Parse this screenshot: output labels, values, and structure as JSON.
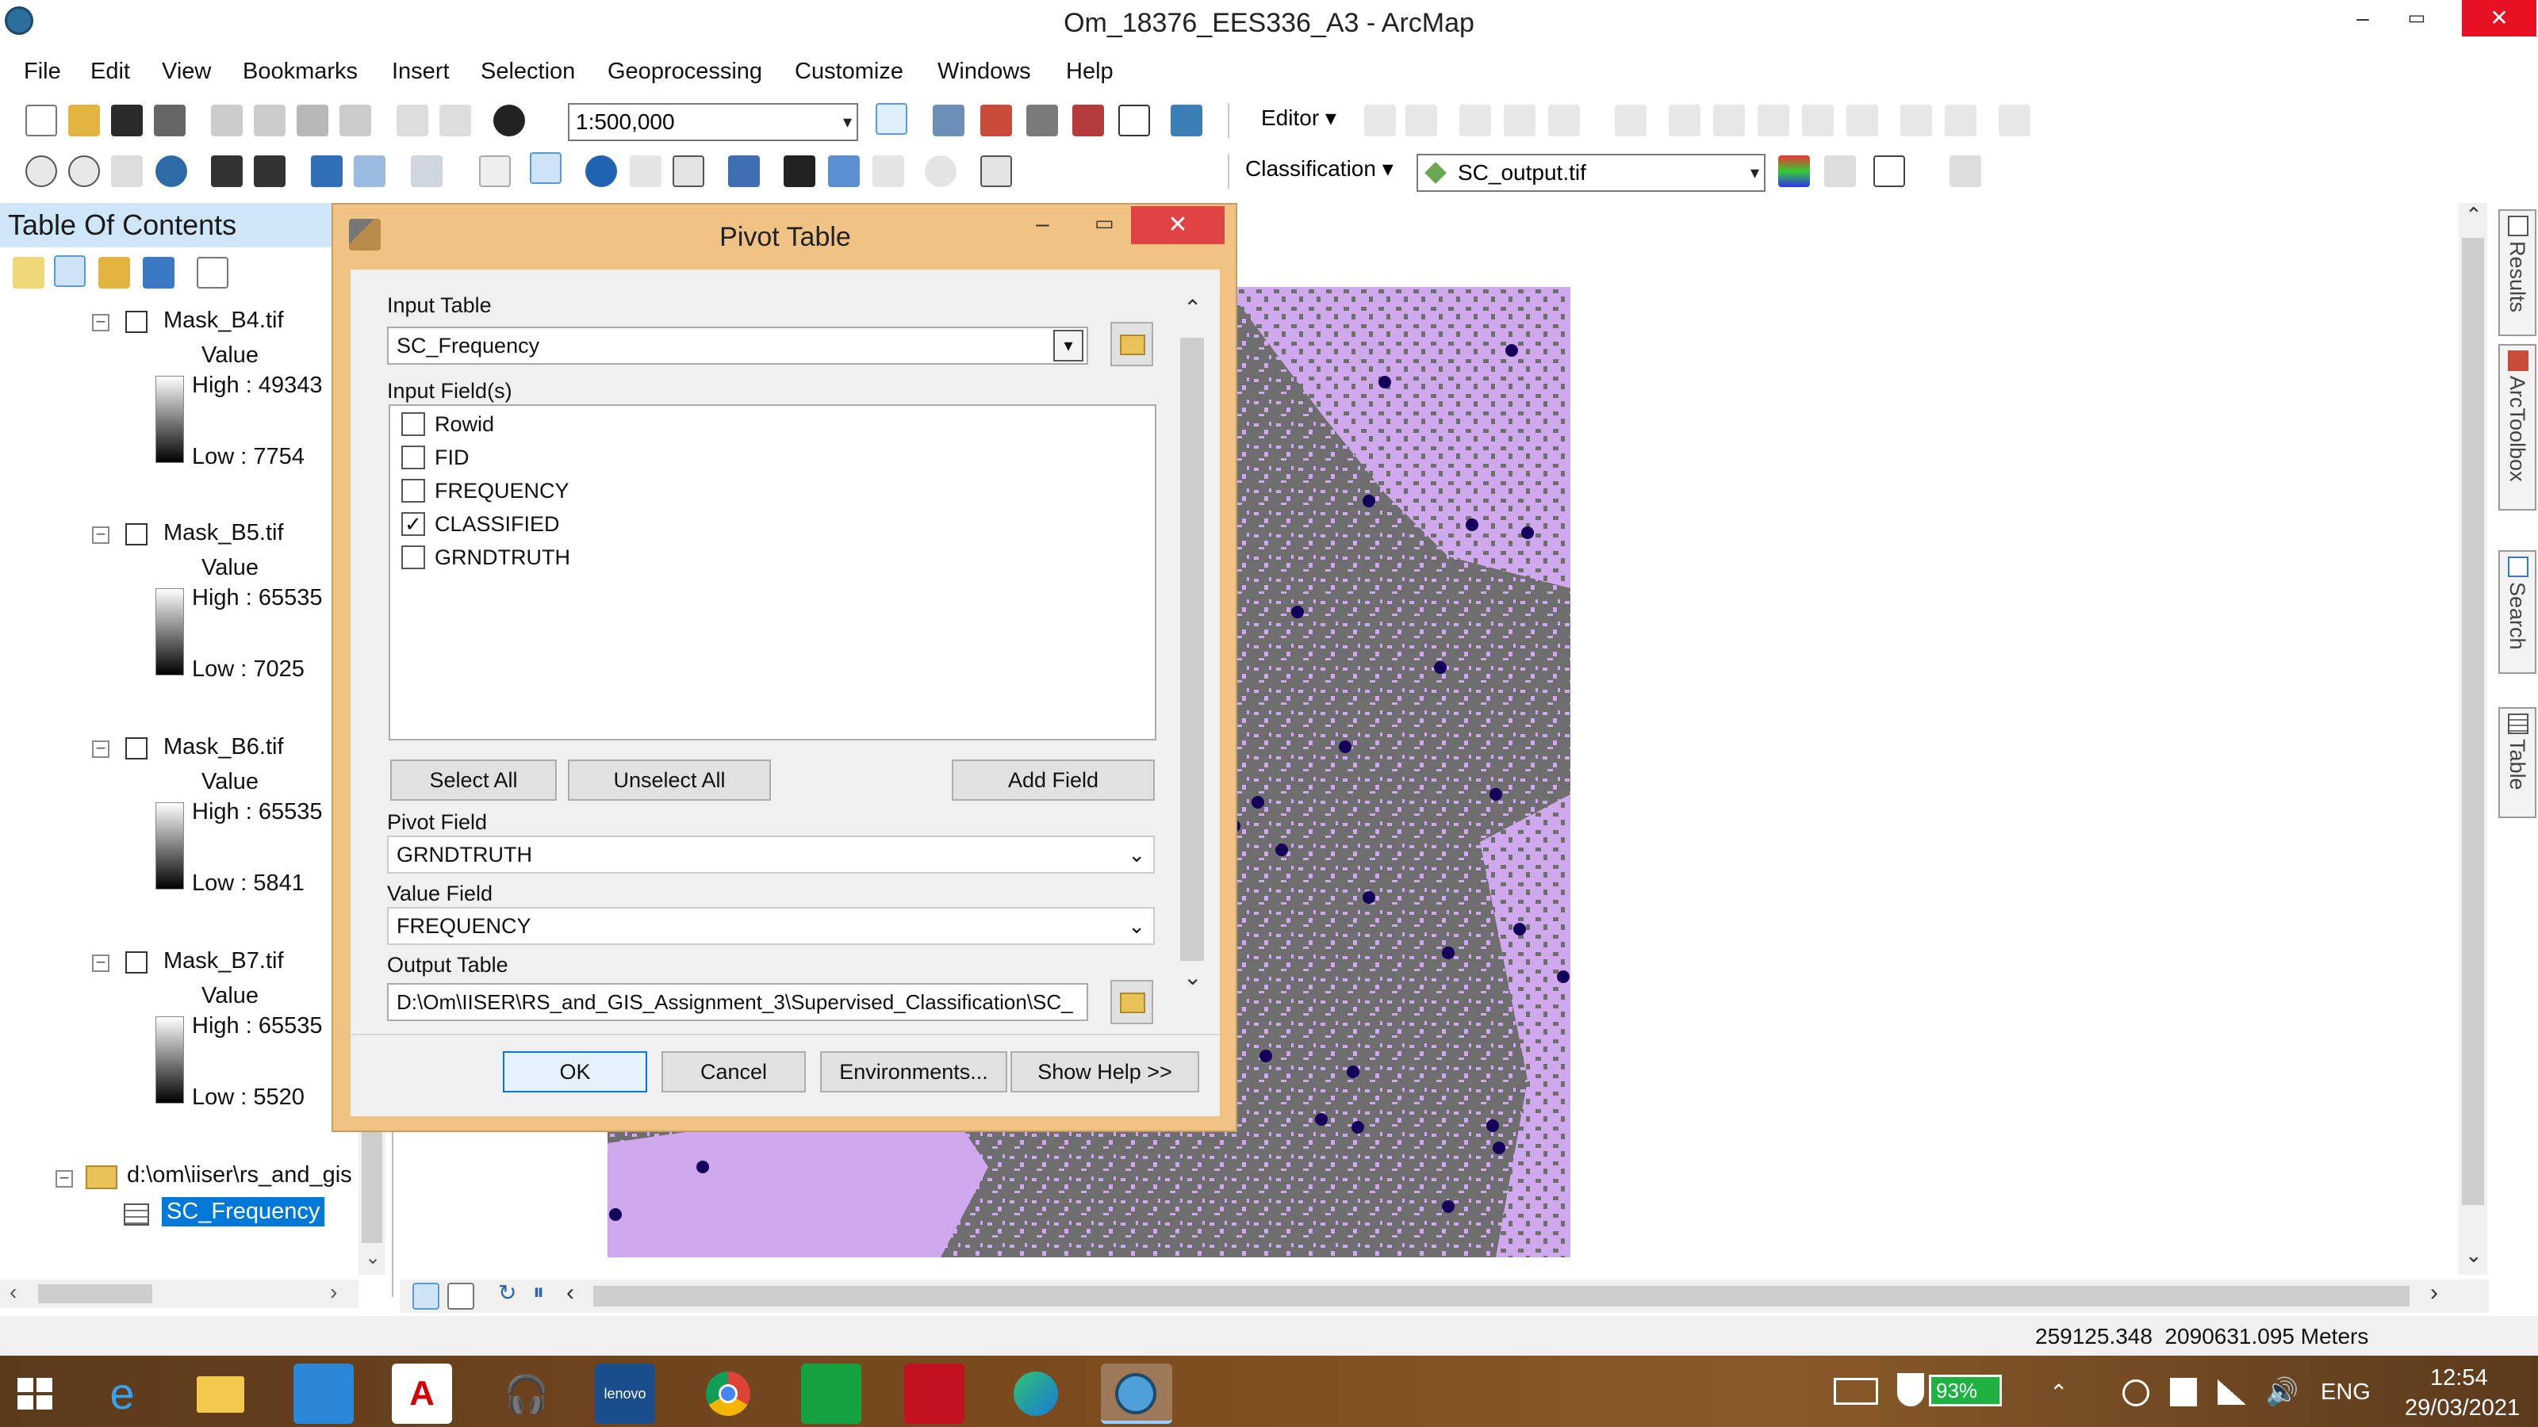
{
  "window": {
    "title": "Om_18376_EES336_A3 - ArcMap",
    "controls": [
      "–",
      "▭",
      "✕"
    ]
  },
  "menu": [
    "File",
    "Edit",
    "View",
    "Bookmarks",
    "Insert",
    "Selection",
    "Geoprocessing",
    "Customize",
    "Windows",
    "Help"
  ],
  "toolbar": {
    "scale": "1:500,000",
    "editor_label": "Editor",
    "classification_label": "Classification",
    "layer_select": "SC_output.tif"
  },
  "toc": {
    "header": "Table Of Contents",
    "layers": [
      {
        "name": "Mask_B4.tif",
        "value_label": "Value",
        "high": "High : 49343",
        "low": "Low : 7754"
      },
      {
        "name": "Mask_B5.tif",
        "value_label": "Value",
        "high": "High : 65535",
        "low": "Low : 7025"
      },
      {
        "name": "Mask_B6.tif",
        "value_label": "Value",
        "high": "High : 65535",
        "low": "Low : 5841"
      },
      {
        "name": "Mask_B7.tif",
        "value_label": "Value",
        "high": "High : 65535",
        "low": "Low : 5520"
      }
    ],
    "folder": "d:\\om\\iiser\\rs_and_gis",
    "table": "SC_Frequency"
  },
  "dialog": {
    "title": "Pivot Table",
    "input_table_label": "Input Table",
    "input_table_value": "SC_Frequency",
    "input_fields_label": "Input Field(s)",
    "fields": [
      {
        "name": "Rowid",
        "checked": false
      },
      {
        "name": "FID",
        "checked": false
      },
      {
        "name": "FREQUENCY",
        "checked": false
      },
      {
        "name": "CLASSIFIED",
        "checked": true
      },
      {
        "name": "GRNDTRUTH",
        "checked": false
      }
    ],
    "select_all": "Select All",
    "unselect_all": "Unselect All",
    "add_field": "Add Field",
    "pivot_field_label": "Pivot Field",
    "pivot_field_value": "GRNDTRUTH",
    "value_field_label": "Value Field",
    "value_field_value": "FREQUENCY",
    "output_table_label": "Output Table",
    "output_table_value": "D:\\Om\\IISER\\RS_and_GIS_Assignment_3\\Supervised_Classification\\SC_",
    "ok": "OK",
    "cancel": "Cancel",
    "environments": "Environments...",
    "show_help": "Show Help >>"
  },
  "side_tabs": [
    "Results",
    "ArcToolbox",
    "Search",
    "Table"
  ],
  "status": {
    "coords": "259125.348  2090631.095 Meters"
  },
  "taskbar": {
    "battery": "93%",
    "language": "ENG",
    "time": "12:54",
    "date": "29/03/2021"
  },
  "colors": {
    "dialog_frame": "#f0c283",
    "toc_header": "#cfe6f8",
    "raster_light": "#cfa8ee",
    "raster_dark": "#6e6e6e",
    "points": "#14005a"
  }
}
